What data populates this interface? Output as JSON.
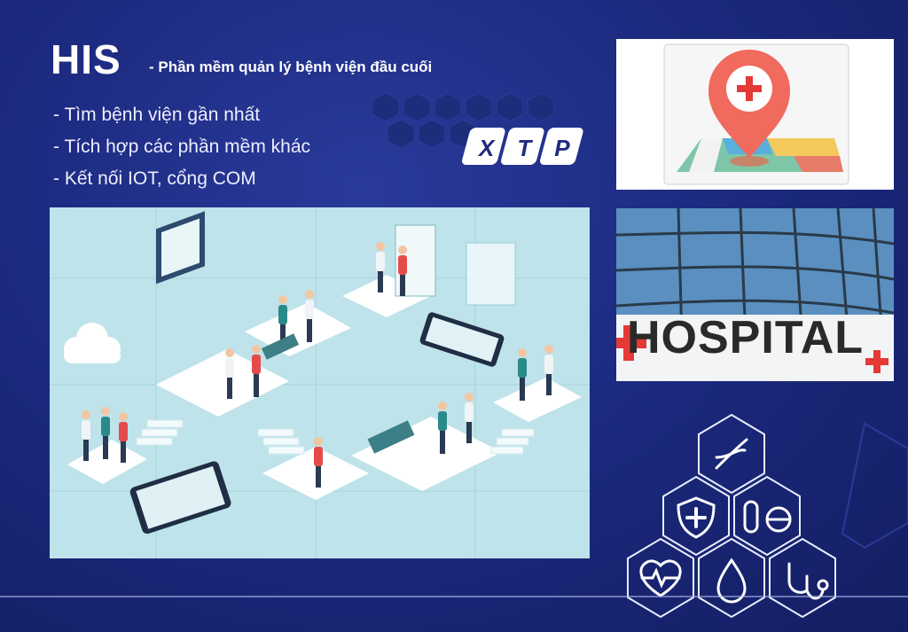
{
  "header": {
    "title": "HIS",
    "subtitle": "- Phần mềm quản lý bệnh viện đầu cuối"
  },
  "features": [
    "- Tìm bệnh viện gần nhất",
    "- Tích hợp các phần mềm khác",
    "- Kết nối IOT, cổng COM"
  ],
  "logo": {
    "text": "XTP"
  },
  "hospital_photo": {
    "sign_text": "HOSPITAL"
  },
  "colors": {
    "background": "#1c2a80",
    "accent_red": "#e53935",
    "teal": "#bfe3ea"
  },
  "icons": [
    "dna-icon",
    "shield-plus-icon",
    "pill-icon",
    "heart-pulse-icon",
    "drop-icon",
    "stethoscope-icon",
    "map-pin-hospital-icon"
  ]
}
